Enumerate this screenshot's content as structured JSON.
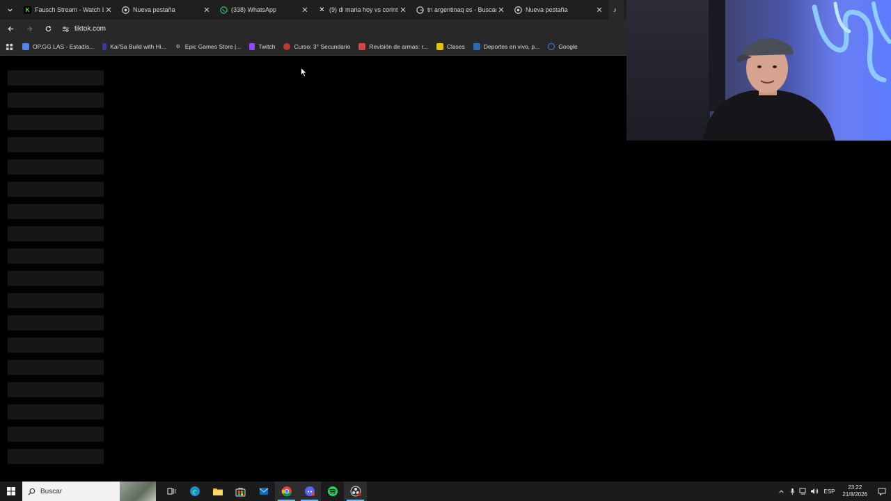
{
  "tabs": [
    {
      "title": "Fausch Stream - Watch Liv",
      "icon": "kick-icon",
      "color": "#53fc18"
    },
    {
      "title": "Nueva pestaña",
      "icon": "chrome-icon",
      "color": "#cccccc"
    },
    {
      "title": "(338) WhatsApp",
      "icon": "whatsapp-icon",
      "color": "#25d366"
    },
    {
      "title": "(9) di maria hoy vs corinth",
      "icon": "x-icon",
      "color": "#ffffff"
    },
    {
      "title": "tn argentinaq es - Buscar c",
      "icon": "google-icon",
      "color": "#cccccc"
    },
    {
      "title": "Nueva pestaña",
      "icon": "chrome-icon",
      "color": "#cccccc"
    }
  ],
  "toolbar": {
    "url": "tiktok.com"
  },
  "bookmarks": [
    {
      "label": "OP.GG LAS - Estadís...",
      "color": "#5383e8"
    },
    {
      "label": "Kai'Sa Build with Hi...",
      "color": "#3b3b9a"
    },
    {
      "label": "Epic Games Store |...",
      "color": "#cfcfcf"
    },
    {
      "label": "Twitch",
      "color": "#9146ff"
    },
    {
      "label": "Curso: 3° Secundario",
      "color": "#c0392b"
    },
    {
      "label": "Revisión de armas: r...",
      "color": "#d04545"
    },
    {
      "label": "Clases",
      "color": "#e5c100"
    },
    {
      "label": "Deportes en vivo, p...",
      "color": "#2b6cb0"
    },
    {
      "label": "Google",
      "color": "#4285f4"
    }
  ],
  "taskbar": {
    "search_placeholder": "Buscar",
    "language": "ESP",
    "time": "23:22",
    "date": "21/8/2026"
  }
}
